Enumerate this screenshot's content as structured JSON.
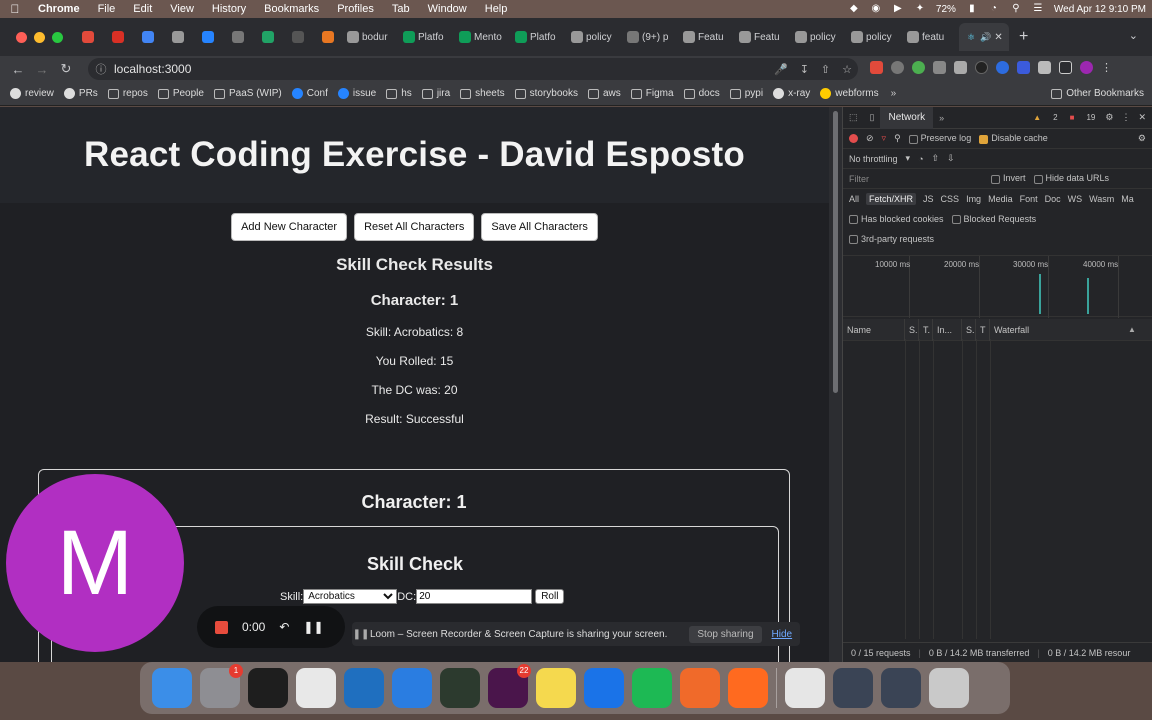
{
  "menubar": {
    "app_name": "Chrome",
    "items": [
      "File",
      "Edit",
      "View",
      "History",
      "Bookmarks",
      "Profiles",
      "Tab",
      "Window",
      "Help"
    ],
    "battery": "72%",
    "clock": "Wed Apr 12  9:10 PM"
  },
  "tabs": [
    {
      "title": "",
      "color": "#e24a3b",
      "icon": "loom-icon"
    },
    {
      "title": "",
      "color": "#d93025",
      "icon": "gmail-icon"
    },
    {
      "title": "",
      "color": "#4285f4",
      "icon": "calendar-icon"
    },
    {
      "title": "",
      "color": "#999999",
      "icon": "github-icon"
    },
    {
      "title": "",
      "color": "#2684ff",
      "icon": "jira-icon"
    },
    {
      "title": "",
      "color": "#777777",
      "icon": "extension-icon"
    },
    {
      "title": "",
      "color": "#21a366",
      "icon": "spotify-icon"
    },
    {
      "title": "",
      "color": "#555555",
      "icon": "triangle-icon"
    },
    {
      "title": "",
      "color": "#e87722",
      "icon": "box-icon"
    },
    {
      "title": "bodur",
      "color": "#999999",
      "icon": "github-icon"
    },
    {
      "title": "Platfo",
      "color": "#0f9d58",
      "icon": "sheets-icon"
    },
    {
      "title": "Mento",
      "color": "#0f9d58",
      "icon": "sheets-icon"
    },
    {
      "title": "Platfo",
      "color": "#0f9d58",
      "icon": "sheets-icon"
    },
    {
      "title": "policy",
      "color": "#999999",
      "icon": "github-icon"
    },
    {
      "title": "(9+) p",
      "color": "#777777",
      "icon": "window-icon"
    },
    {
      "title": "Featu",
      "color": "#999999",
      "icon": "github-icon"
    },
    {
      "title": "Featu",
      "color": "#999999",
      "icon": "github-icon"
    },
    {
      "title": "policy",
      "color": "#999999",
      "icon": "github-icon"
    },
    {
      "title": "policy",
      "color": "#999999",
      "icon": "github-icon"
    },
    {
      "title": "featu",
      "color": "#999999",
      "icon": "github-icon"
    }
  ],
  "active_tab": {
    "icon": "react-icon",
    "color": "#61dafb"
  },
  "new_tab": "+",
  "url": "localhost:3000",
  "bookmarks": [
    {
      "label": "review",
      "kind": "github"
    },
    {
      "label": "PRs",
      "kind": "github"
    },
    {
      "label": "repos",
      "kind": "folder"
    },
    {
      "label": "People",
      "kind": "folder"
    },
    {
      "label": "PaaS (WIP)",
      "kind": "folder"
    },
    {
      "label": "Conf",
      "kind": "confluence"
    },
    {
      "label": "issue",
      "kind": "jira"
    },
    {
      "label": "hs",
      "kind": "folder"
    },
    {
      "label": "jira",
      "kind": "folder"
    },
    {
      "label": "sheets",
      "kind": "folder"
    },
    {
      "label": "storybooks",
      "kind": "folder"
    },
    {
      "label": "aws",
      "kind": "folder"
    },
    {
      "label": "Figma",
      "kind": "folder"
    },
    {
      "label": "docs",
      "kind": "folder"
    },
    {
      "label": "pypi",
      "kind": "folder"
    },
    {
      "label": "x-ray",
      "kind": "github"
    },
    {
      "label": "webforms",
      "kind": "star"
    }
  ],
  "bookmarks_more": "»",
  "other_bookmarks": "Other Bookmarks",
  "page": {
    "title": "React Coding Exercise - David Esposto",
    "buttons": [
      "Add New Character",
      "Reset All Characters",
      "Save All Characters"
    ],
    "results_title": "Skill Check Results",
    "results_character": "Character: 1",
    "results_lines": [
      "Skill: Acrobatics: 8",
      "You Rolled: 15",
      "The DC was: 20",
      "Result: Successful"
    ],
    "card_title": "Character: 1",
    "skill_check_title": "Skill Check",
    "skill_label": "Skill:",
    "skill_value": "Acrobatics",
    "dc_label": "DC:",
    "dc_value": "20",
    "roll_label": "Roll"
  },
  "devtools": {
    "tabs": [
      "Network"
    ],
    "more": "»",
    "warnings": "2",
    "errors": "19",
    "preserve_log": "Preserve log",
    "disable_cache": "Disable cache",
    "throttling": "No throttling",
    "filter_placeholder": "Filter",
    "invert": "Invert",
    "hide_data_urls": "Hide data URLs",
    "types": [
      "All",
      "Fetch/XHR",
      "JS",
      "CSS",
      "Img",
      "Media",
      "Font",
      "Doc",
      "WS",
      "Wasm",
      "Ma"
    ],
    "blocked_cookies": "Has blocked cookies",
    "blocked_requests": "Blocked Requests",
    "third_party": "3rd-party requests",
    "timeline_labels": [
      "10000 ms",
      "20000 ms",
      "30000 ms",
      "40000 ms"
    ],
    "columns": [
      "Name",
      "S.",
      "T.",
      "In...",
      "S.",
      "T",
      "Waterfall"
    ],
    "footer": [
      "0 / 15 requests",
      "0 B / 14.2 MB transferred",
      "0 B / 14.2 MB resour"
    ]
  },
  "loom": {
    "avatar_letter": "M",
    "timer": "0:00",
    "share_message": "Loom – Screen Recorder & Screen Capture is sharing your screen.",
    "stop_sharing": "Stop sharing",
    "hide": "Hide"
  },
  "dock": [
    {
      "name": "finder",
      "color": "#3b8ee8"
    },
    {
      "name": "system-preferences",
      "color": "#8e8e93",
      "badge": "1"
    },
    {
      "name": "terminal",
      "color": "#1e1e1e"
    },
    {
      "name": "chrome",
      "color": "#e8e8e8"
    },
    {
      "name": "vscode",
      "color": "#1f6fbf"
    },
    {
      "name": "loom",
      "color": "#2a7de1"
    },
    {
      "name": "activity-monitor",
      "color": "#2c3a2e"
    },
    {
      "name": "slack",
      "color": "#4a154b",
      "badge": "22"
    },
    {
      "name": "notes",
      "color": "#f5d94e"
    },
    {
      "name": "maps",
      "color": "#1a73e8"
    },
    {
      "name": "spotify",
      "color": "#1db954"
    },
    {
      "name": "pages",
      "color": "#f06a2a"
    },
    {
      "name": "firefox",
      "color": "#ff6a1f"
    },
    {
      "name": "document",
      "color": "#e6e6e6"
    },
    {
      "name": "window-1",
      "color": "#3a4455"
    },
    {
      "name": "window-2",
      "color": "#3a4455"
    },
    {
      "name": "trash",
      "color": "#c9c9c9"
    }
  ]
}
